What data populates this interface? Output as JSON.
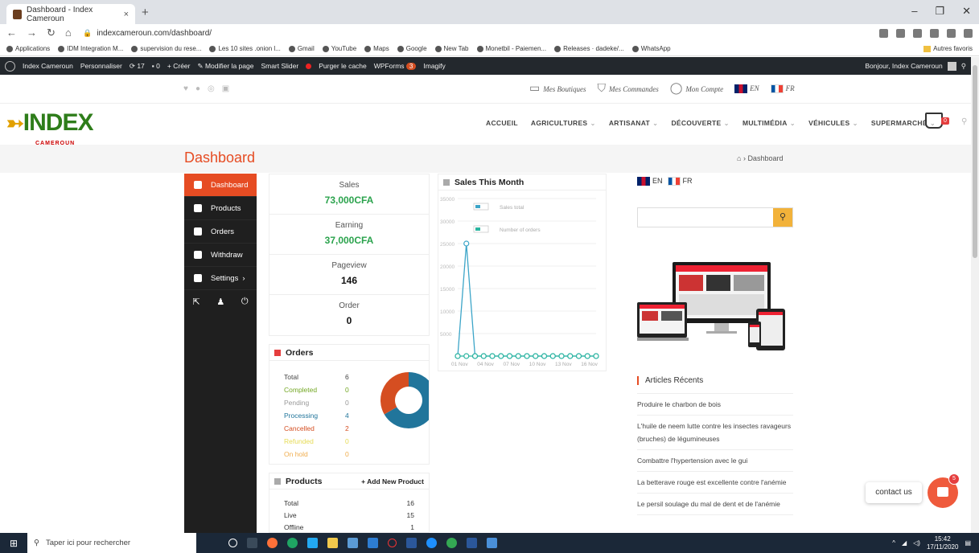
{
  "browser": {
    "tab_title": "Dashboard - Index Cameroun",
    "tab_close": "×",
    "new_tab": "+",
    "url": "indexcameroun.com/dashboard/",
    "bookmarks": [
      "Applications",
      "IDM Integration M...",
      "supervision du rese...",
      "Les 10 sites .onion l...",
      "Gmail",
      "YouTube",
      "Maps",
      "Google",
      "New Tab",
      "Monetbil - Paiemen...",
      "Releases · dadeke/...",
      "WhatsApp"
    ],
    "other_bookmarks": "Autres favoris"
  },
  "adminbar": {
    "site": "Index Cameroun",
    "customize": "Personnaliser",
    "updates": "17",
    "comments": "0",
    "new": "Créer",
    "edit": "Modifier la page",
    "slider": "Smart Slider",
    "purge": "Purger le cache",
    "wpforms": "WPForms",
    "wpforms_badge": "3",
    "imagify": "Imagify",
    "greeting": "Bonjour, Index Cameroun"
  },
  "toplinks": {
    "boutiques": "Mes Boutiques",
    "commandes": "Mes Commandes",
    "compte": "Mon Compte",
    "lang_en": "EN",
    "lang_fr": "FR"
  },
  "logo": {
    "text": "INDEX",
    "sub": "CAMEROUN"
  },
  "nav": {
    "items": [
      "ACCUEIL",
      "AGRICULTURES",
      "ARTISANAT",
      "DÉCOUVERTE",
      "MULTIMÉDIA",
      "VÉHICULES",
      "SUPERMARCHÉ"
    ],
    "cart_count": "0"
  },
  "page": {
    "title": "Dashboard",
    "breadcrumb": "Dashboard"
  },
  "sidebar": {
    "items": [
      {
        "label": "Dashboard"
      },
      {
        "label": "Products"
      },
      {
        "label": "Orders"
      },
      {
        "label": "Withdraw"
      },
      {
        "label": "Settings"
      }
    ],
    "settings_chevron": "›"
  },
  "stats": [
    {
      "label": "Sales",
      "value": "73,000CFA"
    },
    {
      "label": "Earning",
      "value": "37,000CFA"
    },
    {
      "label": "Pageview",
      "value": "146"
    },
    {
      "label": "Order",
      "value": "0"
    }
  ],
  "orders": {
    "title": "Orders",
    "rows": [
      {
        "label": "Total",
        "value": "6",
        "color": "#444444"
      },
      {
        "label": "Completed",
        "value": "0",
        "color": "#73a724"
      },
      {
        "label": "Pending",
        "value": "0",
        "color": "#999999"
      },
      {
        "label": "Processing",
        "value": "4",
        "color": "#21759b"
      },
      {
        "label": "Cancelled",
        "value": "2",
        "color": "#d54e21"
      },
      {
        "label": "Refunded",
        "value": "0",
        "color": "#e6db55"
      },
      {
        "label": "On hold",
        "value": "0",
        "color": "#f0ad4e"
      }
    ]
  },
  "products": {
    "title": "Products",
    "add_label": "+ Add New Product",
    "rows": [
      {
        "label": "Total",
        "value": "16"
      },
      {
        "label": "Live",
        "value": "15"
      },
      {
        "label": "Offline",
        "value": "1"
      }
    ]
  },
  "chart_data": {
    "type": "line",
    "title": "Sales This Month",
    "yticks": [
      "35000",
      "30000",
      "25000",
      "20000",
      "15000",
      "10000",
      "5000"
    ],
    "xticks": [
      "01 Nov",
      "04 Nov",
      "07 Nov",
      "10 Nov",
      "13 Nov",
      "16 Nov"
    ],
    "ylim": [
      0,
      35000
    ],
    "x": [
      "01 Nov",
      "02 Nov",
      "03 Nov",
      "04 Nov",
      "05 Nov",
      "06 Nov",
      "07 Nov",
      "08 Nov",
      "09 Nov",
      "10 Nov",
      "11 Nov",
      "12 Nov",
      "13 Nov",
      "14 Nov",
      "15 Nov",
      "16 Nov",
      "17 Nov"
    ],
    "series": [
      {
        "name": "Sales total",
        "color": "#3ca5c8",
        "values": [
          0,
          25000,
          0,
          0,
          0,
          0,
          0,
          0,
          0,
          0,
          0,
          0,
          0,
          0,
          0,
          0,
          0
        ]
      },
      {
        "name": "Number of orders",
        "color": "#2bb5a0",
        "values": [
          0,
          0,
          0,
          0,
          0,
          0,
          0,
          0,
          0,
          0,
          0,
          0,
          0,
          0,
          0,
          0,
          0
        ]
      }
    ]
  },
  "right": {
    "lang_en": "EN",
    "lang_fr": "FR",
    "recent_title": "Articles Récents",
    "recent": [
      "Produire le charbon de bois",
      "L'huile de neem lutte contre les insectes ravageurs (bruches) de légumineuses",
      "Combattre l'hypertension avec le gui",
      "La betterave rouge est excellente contre l'anémie",
      "Le persil soulage du mal de dent et de l'anémie"
    ]
  },
  "contact": {
    "label": "contact us",
    "badge": "5"
  },
  "taskbar": {
    "search": "Taper ici pour rechercher",
    "time": "15:42",
    "date": "17/11/2020"
  }
}
